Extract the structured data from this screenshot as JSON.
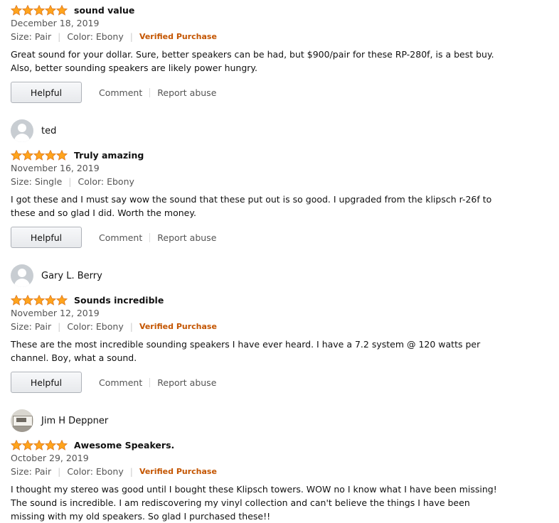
{
  "colors": {
    "star": "#ffa41c",
    "verified": "#c45500",
    "muted": "#555555"
  },
  "reviews": [
    {
      "name": "",
      "rating": 5,
      "title": "sound value",
      "date": "December 18, 2019",
      "size": "Size: Pair",
      "color": "Color: Ebony",
      "verified": "Verified Purchase",
      "text": "Great sound for your dollar. Sure, better speakers can be had, but $900/pair for these RP-280f, is a best buy. Also, better sounding speakers are likely power hungry.",
      "helpful": "Helpful",
      "comment": "Comment",
      "report": "Report abuse"
    },
    {
      "name": "ted",
      "rating": 5,
      "title": "Truly amazing",
      "date": "November 16, 2019",
      "size": "Size: Single",
      "color": "Color: Ebony",
      "verified": "",
      "text": "I got these and I must say wow the sound that these put out is so good. I upgraded from the klipsch r-26f to these and so glad I did. Worth the money.",
      "helpful": "Helpful",
      "comment": "Comment",
      "report": "Report abuse"
    },
    {
      "name": "Gary L. Berry",
      "rating": 5,
      "title": "Sounds incredible",
      "date": "November 12, 2019",
      "size": "Size: Pair",
      "color": "Color: Ebony",
      "verified": "Verified Purchase",
      "text": "These are the most incredible sounding speakers I have ever heard. I have a 7.2 system @ 120 watts per channel. Boy, what a sound.",
      "helpful": "Helpful",
      "comment": "Comment",
      "report": "Report abuse"
    },
    {
      "name": "Jim H Deppner",
      "rating": 5,
      "title": "Awesome Speakers.",
      "date": "October 29, 2019",
      "size": "Size: Pair",
      "color": "Color: Ebony",
      "verified": "Verified Purchase",
      "text": "I thought my stereo was good until I bought these Klipsch towers. WOW no I know what I have been missing! The sound is incredible. I am rediscovering my vinyl collection and can't believe the things I have been missing with my old speakers. So glad I purchased these!!"
    }
  ]
}
